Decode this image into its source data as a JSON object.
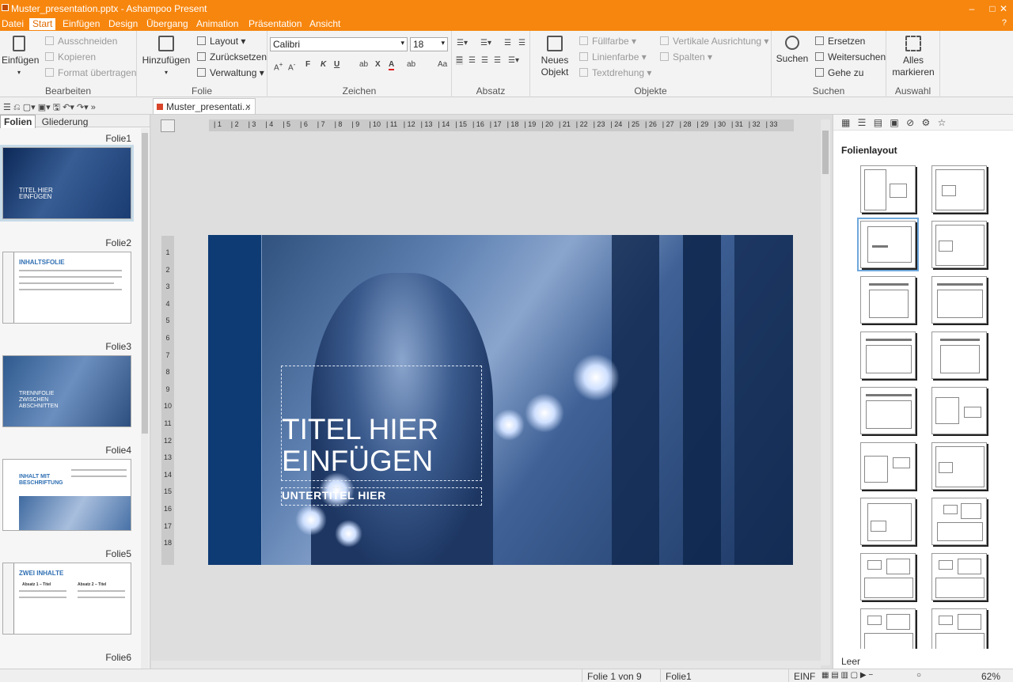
{
  "window": {
    "title": "Muster_presentation.pptx - Ashampoo Present",
    "minimize": "–",
    "maximize": "□",
    "close": "✕"
  },
  "menu": {
    "items": [
      "Datei",
      "Start",
      "Einfügen",
      "Design",
      "Übergang",
      "Animation",
      "Präsentation",
      "Ansicht"
    ],
    "active": "Start",
    "help": "?"
  },
  "ribbon": {
    "bearbeiten": {
      "label": "Bearbeiten",
      "einfuegen": "Einfügen",
      "ausschneiden": "Ausschneiden",
      "kopieren": "Kopieren",
      "format": "Format übertragen"
    },
    "folie": {
      "label": "Folie",
      "hinzufuegen": "Hinzufügen",
      "layout": "Layout",
      "zuruecksetzen": "Zurücksetzen",
      "verwaltung": "Verwaltung"
    },
    "zeichen": {
      "label": "Zeichen",
      "font": "Calibri",
      "size": "18",
      "bold": "F",
      "italic": "K",
      "underline": "U"
    },
    "absatz": {
      "label": "Absatz"
    },
    "objekte": {
      "label": "Objekte",
      "neues_objekt_1": "Neues",
      "neues_objekt_2": "Objekt",
      "fuellfarbe": "Füllfarbe",
      "linienfarbe": "Linienfarbe",
      "textdrehung": "Textdrehung",
      "vertikal": "Vertikale Ausrichtung",
      "spalten": "Spalten"
    },
    "suchen": {
      "label": "Suchen",
      "suchen": "Suchen",
      "ersetzen": "Ersetzen",
      "weitersuchen": "Weitersuchen",
      "gehe_zu": "Gehe zu"
    },
    "auswahl": {
      "label": "Auswahl",
      "alles_1": "Alles",
      "alles_2": "markieren"
    }
  },
  "doc_tab": {
    "name": "Muster_presentati...",
    "close": "×"
  },
  "left_panel": {
    "tab_folien": "Folien",
    "tab_gliederung": "Gliederung",
    "slides": [
      {
        "label": "Folie1",
        "text": "TITEL HIER EINFÜGEN"
      },
      {
        "label": "Folie2",
        "text": "INHALTSFOLIE"
      },
      {
        "label": "Folie3",
        "text": "TRENNFOLIE ZWISCHEN ABSCHNITTEN"
      },
      {
        "label": "Folie4",
        "text": "INHALT MIT BESCHRIFTUNG"
      },
      {
        "label": "Folie5",
        "text": "ZWEI INHALTE",
        "col1": "Absatz 1 – Titel",
        "col2": "Absatz 2 – Titel"
      },
      {
        "label": "Folie6"
      }
    ]
  },
  "ruler": {
    "h": [
      "1",
      "2",
      "3",
      "4",
      "5",
      "6",
      "7",
      "8",
      "9",
      "10",
      "11",
      "12",
      "13",
      "14",
      "15",
      "16",
      "17",
      "18",
      "19",
      "20",
      "21",
      "22",
      "23",
      "24",
      "25",
      "26",
      "27",
      "28",
      "29",
      "30",
      "31",
      "32",
      "33"
    ],
    "v": [
      "1",
      "2",
      "3",
      "4",
      "5",
      "6",
      "7",
      "8",
      "9",
      "10",
      "11",
      "12",
      "13",
      "14",
      "15",
      "16",
      "17",
      "18"
    ]
  },
  "slide": {
    "title_line1": "TITEL HIER",
    "title_line2": "EINFÜGEN",
    "subtitle": "UNTERTITEL HIER"
  },
  "right_panel": {
    "heading": "Folienlayout",
    "footer": "Leer",
    "tools": "▦ ☰ ▤ ▣ ⊘ ⚙ ☆"
  },
  "status": {
    "slide": "Folie 1 von 9",
    "name": "Folie1",
    "mode": "EINF",
    "zoom": "62%"
  },
  "colors": {
    "accent": "#f7860e",
    "slide_blue": "#0e3b74"
  }
}
